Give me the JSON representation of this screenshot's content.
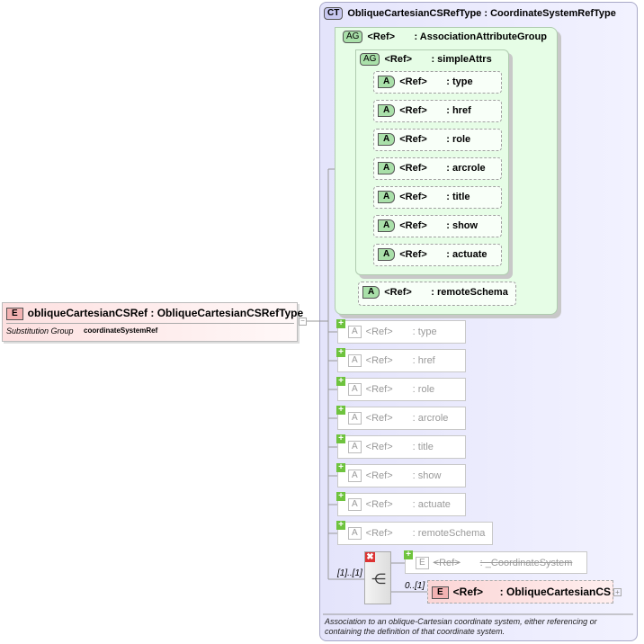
{
  "complex_type": {
    "badge": "CT",
    "name": "ObliqueCartesianCSRefType",
    "base": ": CoordinateSystemRefType"
  },
  "attr_group": {
    "badge": "AG",
    "ref": "<Ref>",
    "name": ": AssociationAttributeGroup"
  },
  "inner_group": {
    "badge": "AG",
    "ref": "<Ref>",
    "name": ": simpleAttrs"
  },
  "inner_attrs": [
    {
      "badge": "A",
      "ref": "<Ref>",
      "name": ": type"
    },
    {
      "badge": "A",
      "ref": "<Ref>",
      "name": ": href"
    },
    {
      "badge": "A",
      "ref": "<Ref>",
      "name": ": role"
    },
    {
      "badge": "A",
      "ref": "<Ref>",
      "name": ": arcrole"
    },
    {
      "badge": "A",
      "ref": "<Ref>",
      "name": ": title"
    },
    {
      "badge": "A",
      "ref": "<Ref>",
      "name": ": show"
    },
    {
      "badge": "A",
      "ref": "<Ref>",
      "name": ": actuate"
    }
  ],
  "remote_schema": {
    "badge": "A",
    "ref": "<Ref>",
    "name": ": remoteSchema"
  },
  "gray_attrs": [
    {
      "badge": "A",
      "ref": "<Ref>",
      "name": ": type"
    },
    {
      "badge": "A",
      "ref": "<Ref>",
      "name": ": href"
    },
    {
      "badge": "A",
      "ref": "<Ref>",
      "name": ": role"
    },
    {
      "badge": "A",
      "ref": "<Ref>",
      "name": ": arcrole"
    },
    {
      "badge": "A",
      "ref": "<Ref>",
      "name": ": title"
    },
    {
      "badge": "A",
      "ref": "<Ref>",
      "name": ": show"
    },
    {
      "badge": "A",
      "ref": "<Ref>",
      "name": ": actuate"
    },
    {
      "badge": "A",
      "ref": "<Ref>",
      "name": ": remoteSchema"
    }
  ],
  "sequence": {
    "cardinality": "[1]..[1]"
  },
  "coord_system": {
    "badge": "E",
    "ref": "<Ref>",
    "name": ": _CoordinateSystem"
  },
  "oblique_cs": {
    "badge": "E",
    "ref": "<Ref>",
    "name": ": ObliqueCartesianCS",
    "cardinality": "0..[1]"
  },
  "description": "Association to an oblique-Cartesian coordinate system, either referencing or containing the definition of that coordinate system.",
  "element": {
    "badge": "E",
    "name": "obliqueCartesianCSRef",
    "type": ": ObliqueCartesianCSRefType",
    "subst_label": "Substitution Group",
    "subst_value": "coordinateSystemRef"
  }
}
